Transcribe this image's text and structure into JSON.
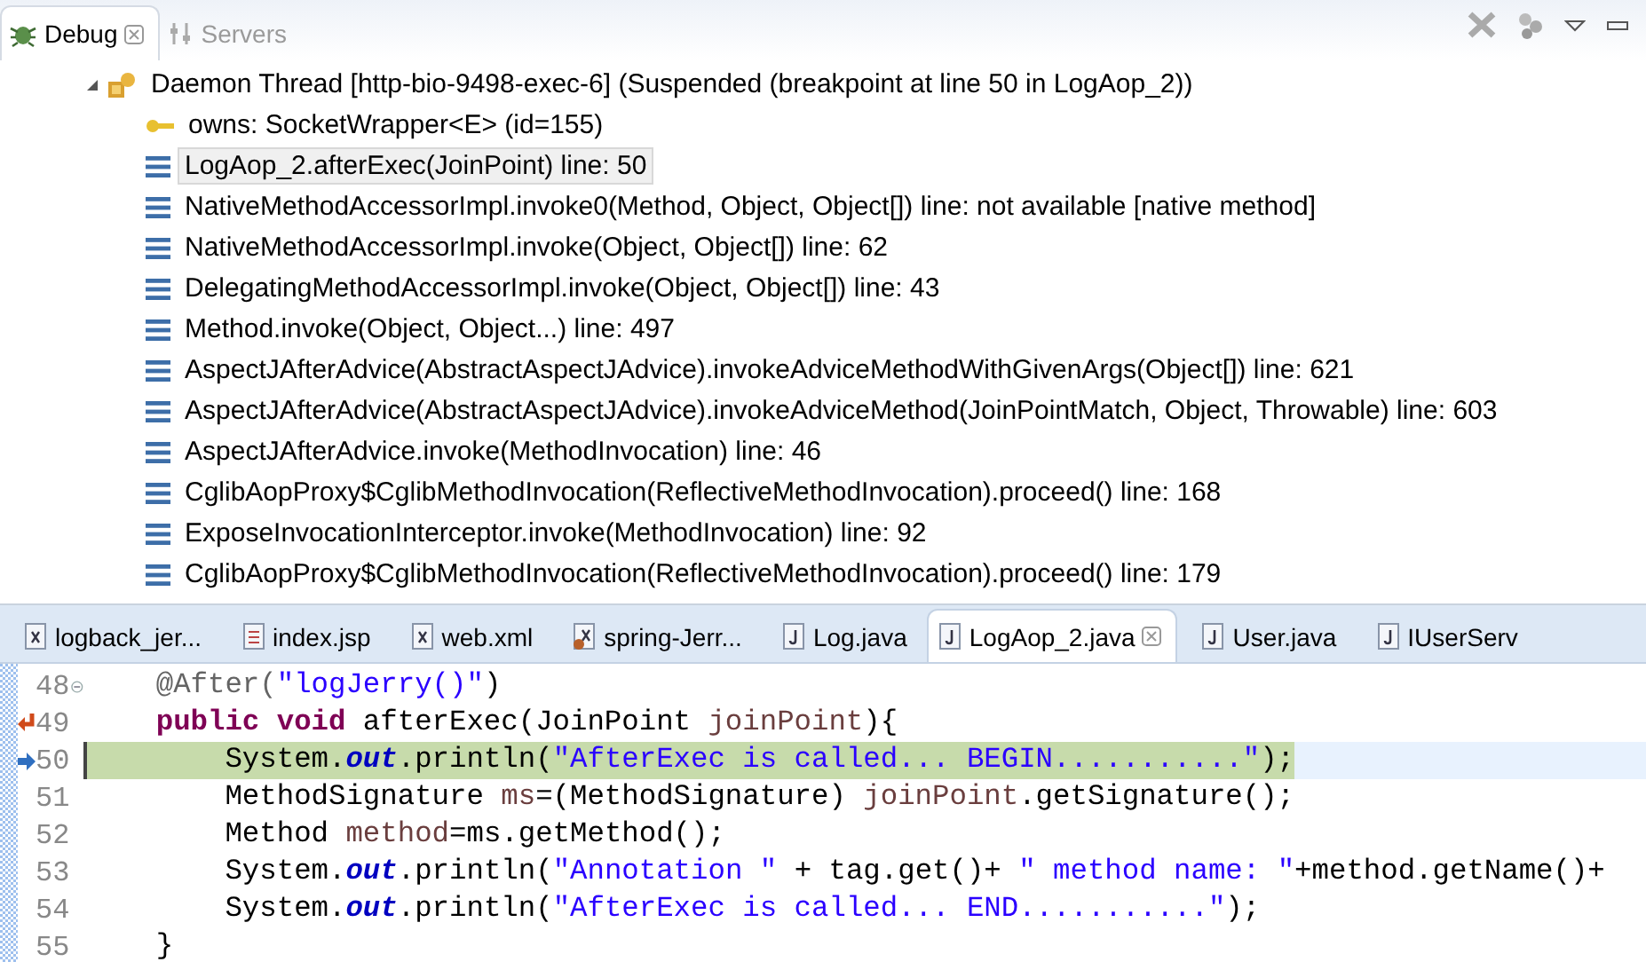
{
  "debug_view": {
    "tabs": [
      {
        "label": "Debug",
        "selected": true,
        "kind": "debug"
      },
      {
        "label": "Servers",
        "selected": false,
        "kind": "servers"
      }
    ],
    "thread": {
      "label": "Daemon Thread [http-bio-9498-exec-6] (Suspended (breakpoint at line 50 in LogAop_2))",
      "expanded": true,
      "children": [
        {
          "kind": "monitor",
          "label": "owns: SocketWrapper<E>  (id=155)",
          "selected": false
        },
        {
          "kind": "frame",
          "label": "LogAop_2.afterExec(JoinPoint) line: 50",
          "selected": true
        },
        {
          "kind": "frame",
          "label": "NativeMethodAccessorImpl.invoke0(Method, Object, Object[]) line: not available [native method]",
          "selected": false
        },
        {
          "kind": "frame",
          "label": "NativeMethodAccessorImpl.invoke(Object, Object[]) line: 62",
          "selected": false
        },
        {
          "kind": "frame",
          "label": "DelegatingMethodAccessorImpl.invoke(Object, Object[]) line: 43",
          "selected": false
        },
        {
          "kind": "frame",
          "label": "Method.invoke(Object, Object...) line: 497",
          "selected": false
        },
        {
          "kind": "frame",
          "label": "AspectJAfterAdvice(AbstractAspectJAdvice).invokeAdviceMethodWithGivenArgs(Object[]) line: 621",
          "selected": false
        },
        {
          "kind": "frame",
          "label": "AspectJAfterAdvice(AbstractAspectJAdvice).invokeAdviceMethod(JoinPointMatch, Object, Throwable) line: 603",
          "selected": false
        },
        {
          "kind": "frame",
          "label": "AspectJAfterAdvice.invoke(MethodInvocation) line: 46",
          "selected": false
        },
        {
          "kind": "frame",
          "label": "CglibAopProxy$CglibMethodInvocation(ReflectiveMethodInvocation).proceed() line: 168",
          "selected": false
        },
        {
          "kind": "frame",
          "label": "ExposeInvocationInterceptor.invoke(MethodInvocation) line: 92",
          "selected": false
        },
        {
          "kind": "frame",
          "label": "CglibAopProxy$CglibMethodInvocation(ReflectiveMethodInvocation).proceed() line: 179",
          "selected": false
        }
      ]
    }
  },
  "editor": {
    "tabs": [
      {
        "label": "logback_jer...",
        "kind": "xml",
        "selected": false
      },
      {
        "label": "index.jsp",
        "kind": "jsp",
        "selected": false
      },
      {
        "label": "web.xml",
        "kind": "xml",
        "selected": false
      },
      {
        "label": "spring-Jerr...",
        "kind": "spring",
        "selected": false
      },
      {
        "label": "Log.java",
        "kind": "java",
        "selected": false
      },
      {
        "label": "LogAop_2.java",
        "kind": "java",
        "selected": true
      },
      {
        "label": "User.java",
        "kind": "java",
        "selected": false
      },
      {
        "label": "IUserServ",
        "kind": "java",
        "selected": false
      }
    ],
    "lines": [
      {
        "number": "48",
        "kind": "fold",
        "current": false,
        "tokens": [
          {
            "kind": "annotation",
            "text": "    @After("
          },
          {
            "kind": "string",
            "text": "\"logJerry()\""
          },
          {
            "kind": "plain",
            "text": ")"
          }
        ]
      },
      {
        "number": "49",
        "kind": "override",
        "current": false,
        "tokens": [
          {
            "kind": "keyword",
            "text": "    public void"
          },
          {
            "kind": "plain",
            "text": " afterExec(JoinPoint "
          },
          {
            "kind": "local",
            "text": "joinPoint"
          },
          {
            "kind": "plain",
            "text": "){"
          }
        ]
      },
      {
        "number": "50",
        "kind": "pointer",
        "current": true,
        "tokens": [
          {
            "kind": "plain",
            "text": "        System."
          },
          {
            "kind": "field",
            "text": "out"
          },
          {
            "kind": "plain",
            "text": ".println("
          },
          {
            "kind": "string",
            "text": "\"AfterExec is called... BEGIN...........\""
          },
          {
            "kind": "plain",
            "text": ");"
          }
        ]
      },
      {
        "number": "51",
        "kind": "plain",
        "current": false,
        "tokens": [
          {
            "kind": "plain",
            "text": "        MethodSignature "
          },
          {
            "kind": "local",
            "text": "ms"
          },
          {
            "kind": "plain",
            "text": "=(MethodSignature) "
          },
          {
            "kind": "local",
            "text": "joinPoint"
          },
          {
            "kind": "plain",
            "text": ".getSignature();"
          }
        ]
      },
      {
        "number": "52",
        "kind": "plain",
        "current": false,
        "tokens": [
          {
            "kind": "plain",
            "text": "        Method "
          },
          {
            "kind": "local",
            "text": "method"
          },
          {
            "kind": "plain",
            "text": "=ms.getMethod();"
          }
        ]
      },
      {
        "number": "53",
        "kind": "plain",
        "current": false,
        "tokens": [
          {
            "kind": "plain",
            "text": "        System."
          },
          {
            "kind": "field",
            "text": "out"
          },
          {
            "kind": "plain",
            "text": ".println("
          },
          {
            "kind": "string",
            "text": "\"Annotation \""
          },
          {
            "kind": "plain",
            "text": " + tag.get()+ "
          },
          {
            "kind": "string",
            "text": "\" method name: \""
          },
          {
            "kind": "plain",
            "text": "+method.getName()+"
          }
        ]
      },
      {
        "number": "54",
        "kind": "plain",
        "current": false,
        "tokens": [
          {
            "kind": "plain",
            "text": "        System."
          },
          {
            "kind": "field",
            "text": "out"
          },
          {
            "kind": "plain",
            "text": ".println("
          },
          {
            "kind": "string",
            "text": "\"AfterExec is called... END...........\""
          },
          {
            "kind": "plain",
            "text": ");"
          }
        ]
      },
      {
        "number": "55",
        "kind": "plain",
        "current": false,
        "tokens": [
          {
            "kind": "plain",
            "text": "    }"
          }
        ]
      }
    ]
  }
}
